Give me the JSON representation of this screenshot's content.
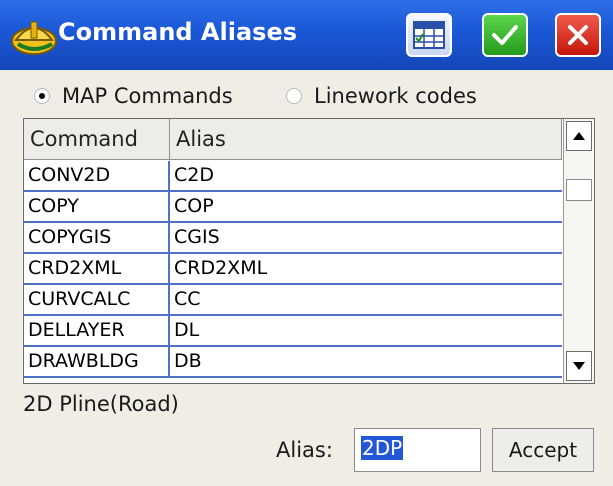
{
  "window": {
    "title": "Command Aliases"
  },
  "icons": {
    "app": "hard-hat-icon",
    "grid": "grid-select-icon",
    "ok": "checkmark-icon",
    "close": "close-icon"
  },
  "colors": {
    "titlebar": "#1a57d6",
    "ok_button": "#2ea824",
    "close_button": "#d8281a",
    "row_lines": "#4f72c9",
    "selection": "#2357d8"
  },
  "mode": {
    "options": [
      {
        "label": "MAP Commands",
        "selected": true
      },
      {
        "label": "Linework codes",
        "selected": false
      }
    ]
  },
  "table": {
    "columns": [
      "Command",
      "Alias"
    ],
    "rows": [
      {
        "command": "CONV2D",
        "alias": "C2D"
      },
      {
        "command": "COPY",
        "alias": "COP"
      },
      {
        "command": "COPYGIS",
        "alias": "CGIS"
      },
      {
        "command": "CRD2XML",
        "alias": "CRD2XML"
      },
      {
        "command": "CURVCALC",
        "alias": "CC"
      },
      {
        "command": "DELLAYER",
        "alias": "DL"
      },
      {
        "command": "DRAWBLDG",
        "alias": "DB"
      }
    ]
  },
  "selected_command": {
    "description": "2D Pline(Road)"
  },
  "alias_edit": {
    "label": "Alias:",
    "value": "2DP",
    "value_selected": true
  },
  "accept": {
    "label": "Accept"
  }
}
